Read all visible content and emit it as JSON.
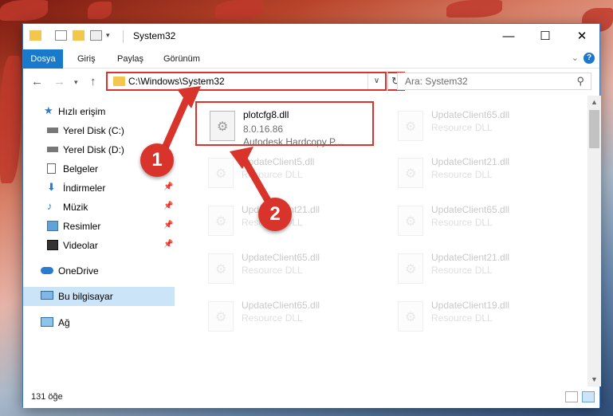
{
  "window": {
    "title": "System32",
    "controls": {
      "minimize": "—",
      "maximize": "☐",
      "close": "✕"
    }
  },
  "ribbon": {
    "tabs": [
      {
        "label": "Dosya",
        "active": true
      },
      {
        "label": "Giriş"
      },
      {
        "label": "Paylaş"
      },
      {
        "label": "Görünüm"
      }
    ],
    "help": "?"
  },
  "nav": {
    "address_path": "C:\\Windows\\System32",
    "search_placeholder": "Ara: System32"
  },
  "sidebar": {
    "items": [
      {
        "label": "Hızlı erişim",
        "icon": "star-icon"
      },
      {
        "label": "Yerel Disk (C:)",
        "icon": "drive-icon",
        "pinned": false
      },
      {
        "label": "Yerel Disk (D:)",
        "icon": "drive-icon",
        "pinned": false
      },
      {
        "label": "Belgeler",
        "icon": "documents-icon",
        "pinned": true
      },
      {
        "label": "İndirmeler",
        "icon": "downloads-icon",
        "pinned": true
      },
      {
        "label": "Müzik",
        "icon": "music-icon",
        "pinned": true
      },
      {
        "label": "Resimler",
        "icon": "pictures-icon",
        "pinned": true
      },
      {
        "label": "Videolar",
        "icon": "videos-icon",
        "pinned": true
      },
      {
        "label": "OneDrive",
        "icon": "cloud-icon"
      },
      {
        "label": "Bu bilgisayar",
        "icon": "computer-icon",
        "selected": true
      },
      {
        "label": "Ağ",
        "icon": "network-icon"
      }
    ]
  },
  "files": [
    {
      "name": "plotcfg8.dll",
      "line1": "8.0.16.86",
      "line2": "Autodesk Hardcopy P...",
      "highlighted": true
    },
    {
      "name": "UpdateClient65.dll",
      "line1": "Resource DLL"
    },
    {
      "name": "UpdateClient5.dll",
      "line1": "Resource DLL"
    },
    {
      "name": "UpdateClient21.dll",
      "line1": "Resource DLL"
    },
    {
      "name": "UpdateClient21.dll",
      "line1": "Resource DLL"
    },
    {
      "name": "UpdateClient65.dll",
      "line1": "Resource DLL"
    },
    {
      "name": "UpdateClient65.dll",
      "line1": "Resource DLL"
    },
    {
      "name": "UpdateClient21.dll",
      "line1": "Resource DLL"
    },
    {
      "name": "UpdateClient65.dll",
      "line1": "Resource DLL"
    },
    {
      "name": "UpdateClient19.dll",
      "line1": "Resource DLL"
    }
  ],
  "status": {
    "count": "131 öğe"
  },
  "annotations": {
    "badge1": "1",
    "badge2": "2"
  },
  "colors": {
    "accent": "#1979ca",
    "highlight": "#d9342b",
    "selection": "#cce4f7"
  }
}
